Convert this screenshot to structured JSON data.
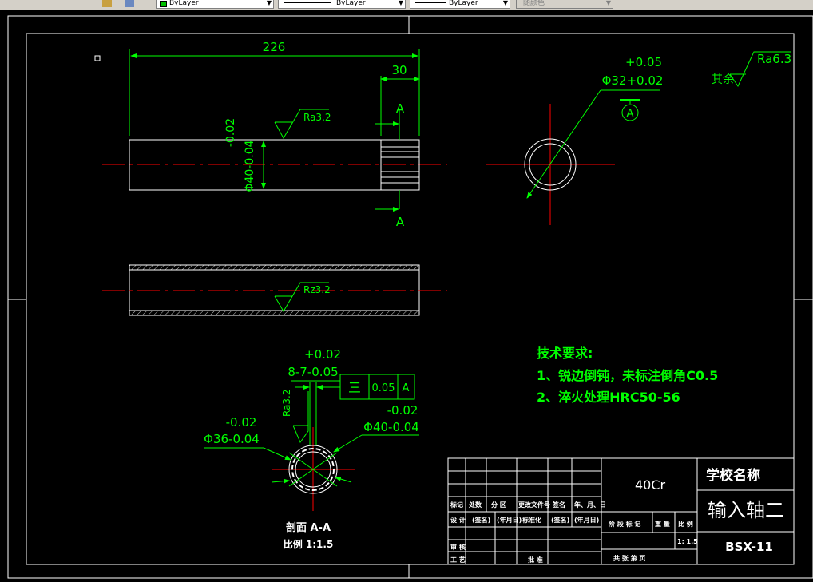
{
  "toolbar": {
    "layer_combo": "ByLayer",
    "linetype_combo": "ByLayer",
    "lineweight_combo": "ByLayer",
    "color_combo": "随颜色"
  },
  "drawing": {
    "dims": {
      "overall_length": "226",
      "spline_length": "30",
      "od_tol_upper": "-0.02",
      "od_value": "Φ40-0.04",
      "bore_tol_upper": "+0.05",
      "bore_value": "Φ32+0.02",
      "sec_width_tol": "+0.02",
      "sec_width": "8-7-0.05",
      "sec_minor_tol": "-0.02",
      "sec_minor": "Φ36-0.04",
      "sec_major_tol": "-0.02",
      "sec_major": "Φ40-0.04"
    },
    "roughness": {
      "top_rest_label": "其余",
      "top_rest_value": "Ra6.3",
      "outer": "Ra3.2",
      "bore": "Rz3.2",
      "spline_side": "Ra3.2"
    },
    "datum_label": "A",
    "section_mark": "A",
    "tolerance_frame": {
      "symbol": "三",
      "value": "0.05",
      "datum": "A"
    },
    "section_title": "剖面 A-A",
    "section_scale": "比例 1:1.5",
    "tech": {
      "title": "技术要求:",
      "line1": "1、锐边倒钝，未标注倒角C0.5",
      "line2": "2、淬火处理HRC50-56"
    }
  },
  "title_block": {
    "material": "40Cr",
    "school": "学校名称",
    "part_name": "输入轴二",
    "drawing_no": "BSX-11",
    "hdr_mark": "标记",
    "hdr_count": "处数",
    "hdr_zone": "分 区",
    "hdr_docno": "更改文件号",
    "hdr_sign": "签名",
    "hdr_date": "年、月、日",
    "design": "设 计",
    "sign1": "(签名)",
    "date1": "(年月日)",
    "standard": "标准化",
    "sign2": "(签名)",
    "date2": "(年月日)",
    "stage": "阶 段 标 记",
    "weight": "重 量",
    "scale_hdr": "比 例",
    "scale_val": "1: 1.5",
    "review": "审 核",
    "process": "工 艺",
    "approve": "批 准",
    "sheets": "共    张    第    页"
  }
}
